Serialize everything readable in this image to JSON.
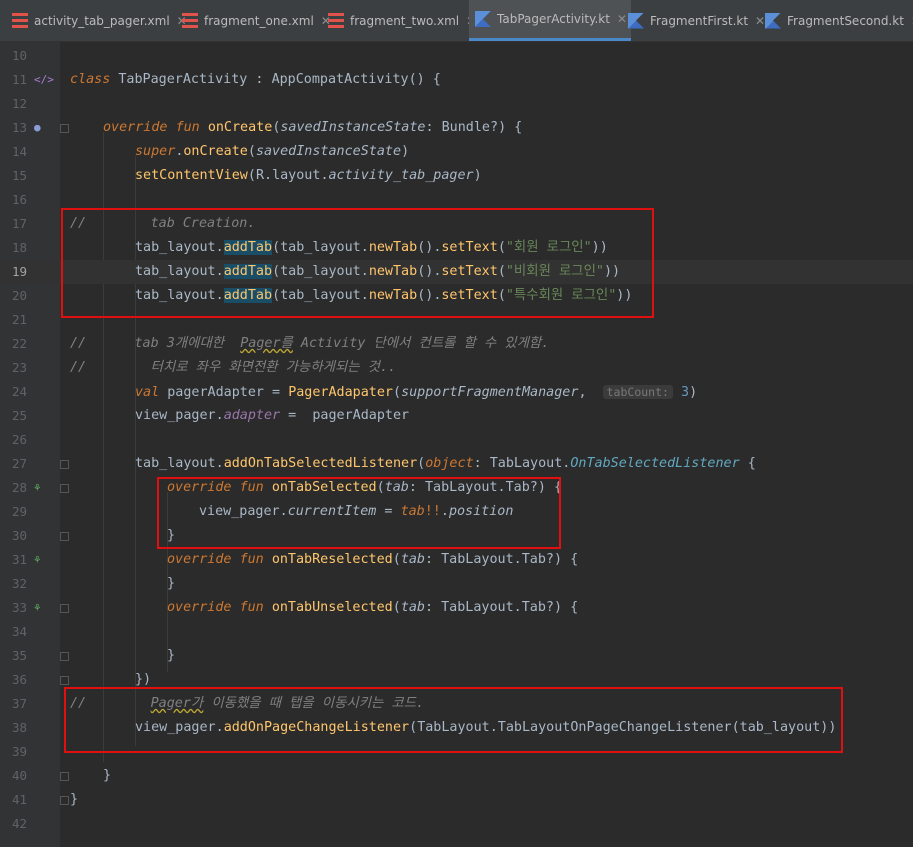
{
  "tabs": [
    {
      "label": "activity_tab_pager.xml",
      "type": "xml"
    },
    {
      "label": "fragment_one.xml",
      "type": "xml"
    },
    {
      "label": "fragment_two.xml",
      "type": "xml"
    },
    {
      "label": "TabPagerActivity.kt",
      "type": "kt",
      "active": true
    },
    {
      "label": "FragmentFirst.kt",
      "type": "kt"
    },
    {
      "label": "FragmentSecond.kt",
      "type": "kt"
    }
  ],
  "close_glyph": "✕",
  "line_numbers": [
    "10",
    "11",
    "12",
    "13",
    "14",
    "15",
    "16",
    "17",
    "18",
    "19",
    "20",
    "21",
    "22",
    "23",
    "24",
    "25",
    "26",
    "27",
    "28",
    "29",
    "30",
    "31",
    "32",
    "33",
    "34",
    "35",
    "36",
    "37",
    "38",
    "39",
    "40",
    "41",
    "42"
  ],
  "code": {
    "l11": {
      "class_kw": "class",
      "name": "TabPagerActivity",
      "colon": " : ",
      "parent": "AppCompatActivity",
      "rest": "() {"
    },
    "l13": {
      "override": "override",
      "fun": "fun",
      "name": "onCreate",
      "open": "(",
      "param": "savedInstanceState",
      "colon": ": ",
      "type": "Bundle?",
      "close": ") {"
    },
    "l14": {
      "super": "super",
      "dot": ".",
      "fn": "onCreate",
      "open": "(",
      "arg": "savedInstanceState",
      "close": ")"
    },
    "l15": {
      "fn": "setContentView",
      "open": "(",
      "r": "R",
      "dot1": ".",
      "layout": "layout",
      "dot2": ".",
      "res": "activity_tab_pager",
      "close": ")"
    },
    "l17": {
      "comment": "//        tab Creation."
    },
    "l18": {
      "obj": "tab_layout",
      "dot": ".",
      "fn": "addTab",
      "open": "(",
      "obj2": "tab_layout",
      "dot2": ".",
      "fn2": "newTab",
      "p": "()",
      "dot3": ".",
      "fn3": "setText",
      "o": "(",
      "str": "\"회원 로그인\"",
      "c": "))"
    },
    "l19": {
      "obj": "tab_layout",
      "dot": ".",
      "fn": "addTab",
      "open": "(",
      "obj2": "tab_layout",
      "dot2": ".",
      "fn2": "newTab",
      "p": "()",
      "dot3": ".",
      "fn3": "setText",
      "o": "(",
      "str": "\"비회원 로그인\"",
      "c": "))"
    },
    "l20": {
      "obj": "tab_layout",
      "dot": ".",
      "fn": "addTab",
      "open": "(",
      "obj2": "tab_layout",
      "dot2": ".",
      "fn2": "newTab",
      "p": "()",
      "dot3": ".",
      "fn3": "setText",
      "o": "(",
      "str": "\"특수회원 로그인\"",
      "c": "))"
    },
    "l22": {
      "comment_a": "//      tab 3개에대한  ",
      "pager": "Pager를",
      "comment_b": " Activity 단에서 컨트롤 할 수 있게함."
    },
    "l23": {
      "comment": "//        터치로 좌우 화면전환 가능하게되는 것.."
    },
    "l24": {
      "val": "val",
      "name": " pagerAdapter = ",
      "fn": "PagerAdapater",
      "open": "(",
      "arg": "supportFragmentManager",
      "comma": ",  ",
      "hint": "tabCount:",
      "num": " 3",
      "close": ")"
    },
    "l25": {
      "obj": "view_pager",
      "dot": ".",
      "prop": "adapter",
      "eq": " =  pagerAdapter"
    },
    "l27": {
      "obj": "tab_layout",
      "dot": ".",
      "fn": "addOnTabSelectedListener",
      "open": "(",
      "obj_kw": "object",
      "colon": ": ",
      "type": "TabLayout",
      "dot2": ".",
      "iface": "OnTabSelectedListener",
      "close": " {"
    },
    "l28": {
      "override": "override",
      "fun": "fun",
      "name": "onTabSelected",
      "open": "(",
      "param": "tab",
      "colon": ": ",
      "type": "TabLayout.Tab?",
      "close": ") {"
    },
    "l29": {
      "obj": "view_pager",
      "dot": ".",
      "prop": "currentItem",
      "eq": " = ",
      "tab": "tab",
      "bang": "!!",
      "dot2": ".",
      "pos": "position"
    },
    "l30": {
      "brace": "}"
    },
    "l31": {
      "override": "override",
      "fun": "fun",
      "name": "onTabReselected",
      "open": "(",
      "param": "tab",
      "colon": ": ",
      "type": "TabLayout.Tab?",
      "close": ") {"
    },
    "l32": {
      "brace": "}"
    },
    "l33": {
      "override": "override",
      "fun": "fun",
      "name": "onTabUnselected",
      "open": "(",
      "param": "tab",
      "colon": ": ",
      "type": "TabLayout.Tab?",
      "close": ") {"
    },
    "l35": {
      "brace": "}"
    },
    "l36": {
      "close": "})"
    },
    "l37": {
      "comment_a": "//        ",
      "pager": "Pager가",
      "comment_b": " 이동했을 때 탭을 이동시키는 코드."
    },
    "l38": {
      "obj": "view_pager",
      "dot": ".",
      "fn": "addOnPageChangeListener",
      "open": "(",
      "cls": "TabLayout.TabLayoutOnPageChangeListener",
      "arg": "(tab_layout))"
    },
    "l40": {
      "brace": "}"
    },
    "l41": {
      "brace": "}"
    }
  }
}
